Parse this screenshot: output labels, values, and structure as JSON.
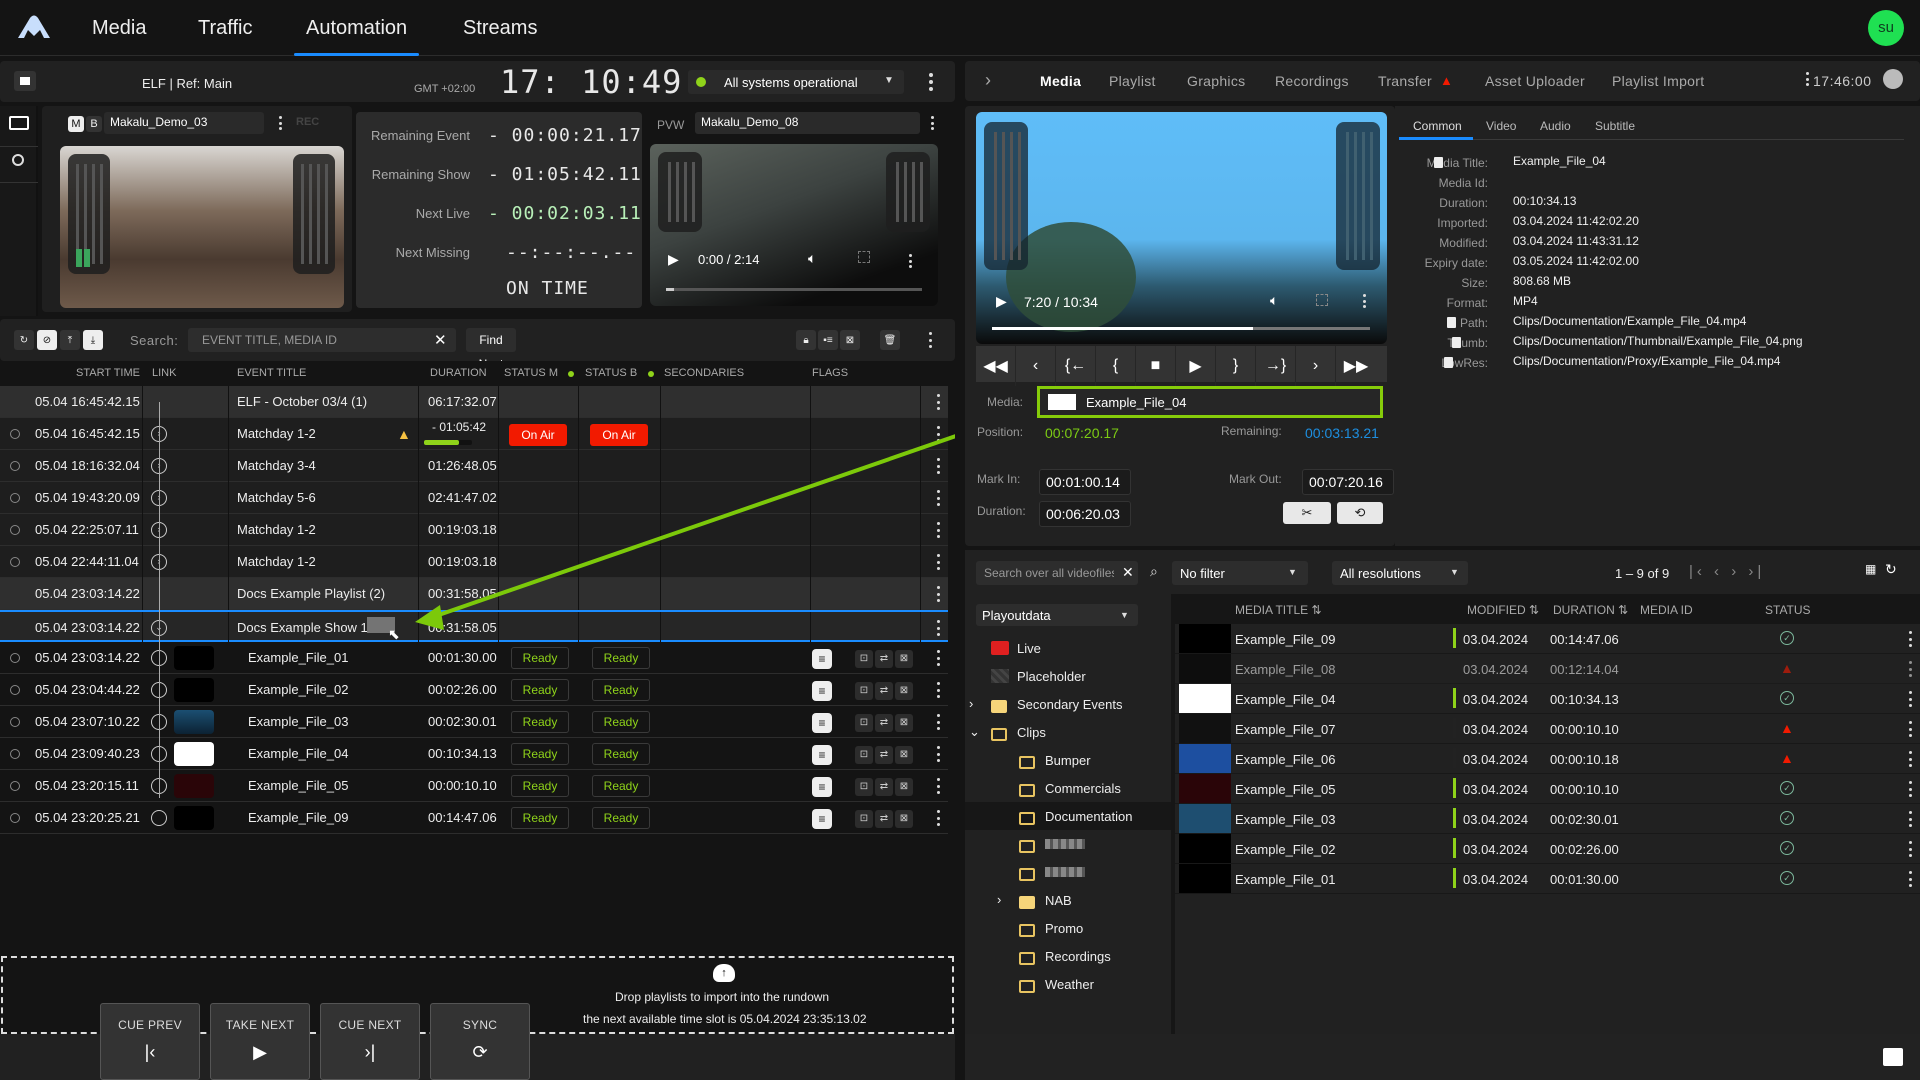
{
  "topnav": {
    "items": [
      "Media",
      "Traffic",
      "Automation",
      "Streams"
    ],
    "active": "Automation",
    "user_initials": "su"
  },
  "channel": {
    "title": "ELF | Ref: Main",
    "timezone": "GMT +02:00",
    "clock": "17: 10:49",
    "status": "All systems operational",
    "status_color": "#8fd31a"
  },
  "program": {
    "mode_m": "M",
    "mode_b": "B",
    "clip": "Makalu_Demo_03",
    "rec": "REC"
  },
  "timers": [
    {
      "label": "Remaining Event",
      "value": "- 00:00:21.17"
    },
    {
      "label": "Remaining Show",
      "value": "- 01:05:42.11"
    },
    {
      "label": "Next Live",
      "value": "- 00:02:03.11"
    },
    {
      "label": "Next Missing",
      "value": "--:--:--.--"
    }
  ],
  "on_time": "ON TIME",
  "preview": {
    "label": "PVW",
    "clip": "Makalu_Demo_08",
    "time": "0:00 / 2:14",
    "progress": 0.0
  },
  "rundown_toolbar": {
    "search_label": "Search:",
    "search_placeholder": "EVENT TITLE, MEDIA ID",
    "find_next": "Find Next"
  },
  "rundown": {
    "columns": [
      "START TIME",
      "LINK",
      "EVENT TITLE",
      "DURATION",
      "STATUS M",
      "STATUS B",
      "SECONDARIES",
      "FLAGS"
    ],
    "rows": [
      {
        "type": "group",
        "start": "05.04  16:45:42.15",
        "title": "ELF - October 03/4 (1)",
        "duration": "06:17:32.07"
      },
      {
        "type": "live",
        "start": "05.04  16:45:42.15",
        "title": "Matchday 1-2",
        "duration": "- 01:05:42",
        "progress": 0.72,
        "status_m": "On Air",
        "status_b": "On Air",
        "warning": true
      },
      {
        "type": "live",
        "start": "05.04  18:16:32.04",
        "title": "Matchday 3-4",
        "duration": "01:26:48.05"
      },
      {
        "type": "live",
        "start": "05.04  19:43:20.09",
        "title": "Matchday 5-6",
        "duration": "02:41:47.02"
      },
      {
        "type": "live",
        "start": "05.04  22:25:07.11",
        "title": "Matchday 1-2",
        "duration": "00:19:03.18"
      },
      {
        "type": "live",
        "start": "05.04  22:44:11.04",
        "title": "Matchday 1-2",
        "duration": "00:19:03.18"
      },
      {
        "type": "group",
        "start": "05.04  23:03:14.22",
        "title": "Docs Example Playlist (2)",
        "duration": "00:31:58.05"
      },
      {
        "type": "show",
        "start": "05.04  23:03:14.22",
        "title": "Docs Example Show 1",
        "duration": "00:31:58.05"
      },
      {
        "type": "file",
        "start": "05.04  23:03:14.22",
        "title": "Example_File_01",
        "duration": "00:01:30.00",
        "status_m": "Ready",
        "status_b": "Ready"
      },
      {
        "type": "file",
        "start": "05.04  23:04:44.22",
        "title": "Example_File_02",
        "duration": "00:02:26.00",
        "status_m": "Ready",
        "status_b": "Ready"
      },
      {
        "type": "file",
        "start": "05.04  23:07:10.22",
        "title": "Example_File_03",
        "duration": "00:02:30.01",
        "status_m": "Ready",
        "status_b": "Ready"
      },
      {
        "type": "file",
        "start": "05.04  23:09:40.23",
        "title": "Example_File_04",
        "duration": "00:10:34.13",
        "status_m": "Ready",
        "status_b": "Ready"
      },
      {
        "type": "file",
        "start": "05.04  23:20:15.11",
        "title": "Example_File_05",
        "duration": "00:00:10.10",
        "status_m": "Ready",
        "status_b": "Ready"
      },
      {
        "type": "file",
        "start": "05.04  23:20:25.21",
        "title": "Example_File_09",
        "duration": "00:14:47.06",
        "status_m": "Ready",
        "status_b": "Ready"
      }
    ]
  },
  "dropzone": {
    "line1": "Drop playlists to import into the rundown",
    "line2": "the next available time slot is 05.04.2024 23:35:13.02"
  },
  "control_buttons": [
    {
      "label": "CUE PREV",
      "icon": "skip-back"
    },
    {
      "label": "TAKE NEXT",
      "icon": "play"
    },
    {
      "label": "CUE NEXT",
      "icon": "skip-forward"
    },
    {
      "label": "SYNC",
      "icon": "sync"
    }
  ],
  "right_tabs": {
    "items": [
      "Media",
      "Playlist",
      "Graphics",
      "Recordings",
      "Transfer",
      "Asset Uploader",
      "Playlist Import"
    ],
    "active": "Media",
    "time": "17:46:00"
  },
  "player": {
    "time": "7:20 / 10:34",
    "progress": 0.69,
    "media_label": "Media:",
    "media": "Example_File_04",
    "position_label": "Position:",
    "position": "00:07:20.17",
    "remaining_label": "Remaining:",
    "remaining": "00:03:13.21",
    "mark_in_label": "Mark In:",
    "mark_in": "00:01:00.14",
    "mark_out_label": "Mark Out:",
    "mark_out": "00:07:20.16",
    "duration_label": "Duration:",
    "duration": "00:06:20.03"
  },
  "details": {
    "tabs": [
      "Common",
      "Video",
      "Audio",
      "Subtitle"
    ],
    "active": "Common",
    "fields": [
      {
        "label": "Media Title:",
        "value": "Example_File_04"
      },
      {
        "label": "Media Id:",
        "value": ""
      },
      {
        "label": "Duration:",
        "value": "00:10:34.13"
      },
      {
        "label": "Imported:",
        "value": "03.04.2024 11:42:02.20"
      },
      {
        "label": "Modified:",
        "value": "03.04.2024 11:43:31.12"
      },
      {
        "label": "Expiry date:",
        "value": "03.05.2024 11:42:02.00"
      },
      {
        "label": "Size:",
        "value": "808.68 MB"
      },
      {
        "label": "Format:",
        "value": "MP4"
      },
      {
        "label": "Path:",
        "value": "Clips/Documentation/Example_File_04.mp4"
      },
      {
        "label": "Thumb:",
        "value": "Clips/Documentation/Thumbnail/Example_File_04.png"
      },
      {
        "label": "LowRes:",
        "value": "Clips/Documentation/Proxy/Example_File_04.mp4"
      }
    ]
  },
  "browser": {
    "search_placeholder": "Search over all videofiles",
    "filter": "No filter",
    "resolution": "All resolutions",
    "pagination": "1 – 9 of 9",
    "source": "Playoutdata",
    "tree": [
      {
        "label": "Live",
        "level": 0,
        "icon": "live"
      },
      {
        "label": "Placeholder",
        "level": 0,
        "icon": "placeholder"
      },
      {
        "label": "Secondary Events",
        "level": 0,
        "icon": "folder-filled",
        "expander": "›"
      },
      {
        "label": "Clips",
        "level": 0,
        "icon": "folder",
        "expander": "⌄"
      },
      {
        "label": "Bumper",
        "level": 1,
        "icon": "folder"
      },
      {
        "label": "Commercials",
        "level": 1,
        "icon": "folder"
      },
      {
        "label": "Documentation",
        "level": 1,
        "icon": "folder",
        "selected": true
      },
      {
        "label": "",
        "level": 1,
        "icon": "folder",
        "blurred": true
      },
      {
        "label": "",
        "level": 1,
        "icon": "folder",
        "blurred": true
      },
      {
        "label": "NAB",
        "level": 1,
        "icon": "folder-filled",
        "expander": "›"
      },
      {
        "label": "Promo",
        "level": 1,
        "icon": "folder"
      },
      {
        "label": "Recordings",
        "level": 1,
        "icon": "folder"
      },
      {
        "label": "Weather",
        "level": 1,
        "icon": "folder"
      }
    ],
    "columns": [
      "MEDIA TITLE",
      "MODIFIED",
      "DURATION",
      "MEDIA ID",
      "STATUS"
    ],
    "rows": [
      {
        "title": "Example_File_09",
        "modified": "03.04.2024",
        "duration": "00:14:47.06",
        "media_id": "",
        "status": "ok",
        "thumb": "#000"
      },
      {
        "title": "Example_File_08",
        "modified": "03.04.2024",
        "duration": "00:12:14.04",
        "media_id": "",
        "status": "error",
        "thumb": "#000",
        "dim": true
      },
      {
        "title": "Example_File_04",
        "modified": "03.04.2024",
        "duration": "00:10:34.13",
        "media_id": "",
        "status": "ok",
        "thumb": "#fff"
      },
      {
        "title": "Example_File_07",
        "modified": "03.04.2024",
        "duration": "00:00:10.10",
        "media_id": "",
        "status": "error",
        "thumb": "#111"
      },
      {
        "title": "Example_File_06",
        "modified": "03.04.2024",
        "duration": "00:00:10.18",
        "media_id": "",
        "status": "error",
        "thumb": "#1d4fa0"
      },
      {
        "title": "Example_File_05",
        "modified": "03.04.2024",
        "duration": "00:00:10.10",
        "media_id": "",
        "status": "ok",
        "thumb": "#2a0508"
      },
      {
        "title": "Example_File_03",
        "modified": "03.04.2024",
        "duration": "00:02:30.01",
        "media_id": "",
        "status": "ok",
        "thumb": "#1e4e70"
      },
      {
        "title": "Example_File_02",
        "modified": "03.04.2024",
        "duration": "00:02:26.00",
        "media_id": "",
        "status": "ok",
        "thumb": "#000"
      },
      {
        "title": "Example_File_01",
        "modified": "03.04.2024",
        "duration": "00:01:30.00",
        "media_id": "",
        "status": "ok",
        "thumb": "#000"
      }
    ]
  },
  "colors": {
    "accent": "#1a8cff",
    "green": "#8fd31a",
    "red": "#f21a00"
  }
}
